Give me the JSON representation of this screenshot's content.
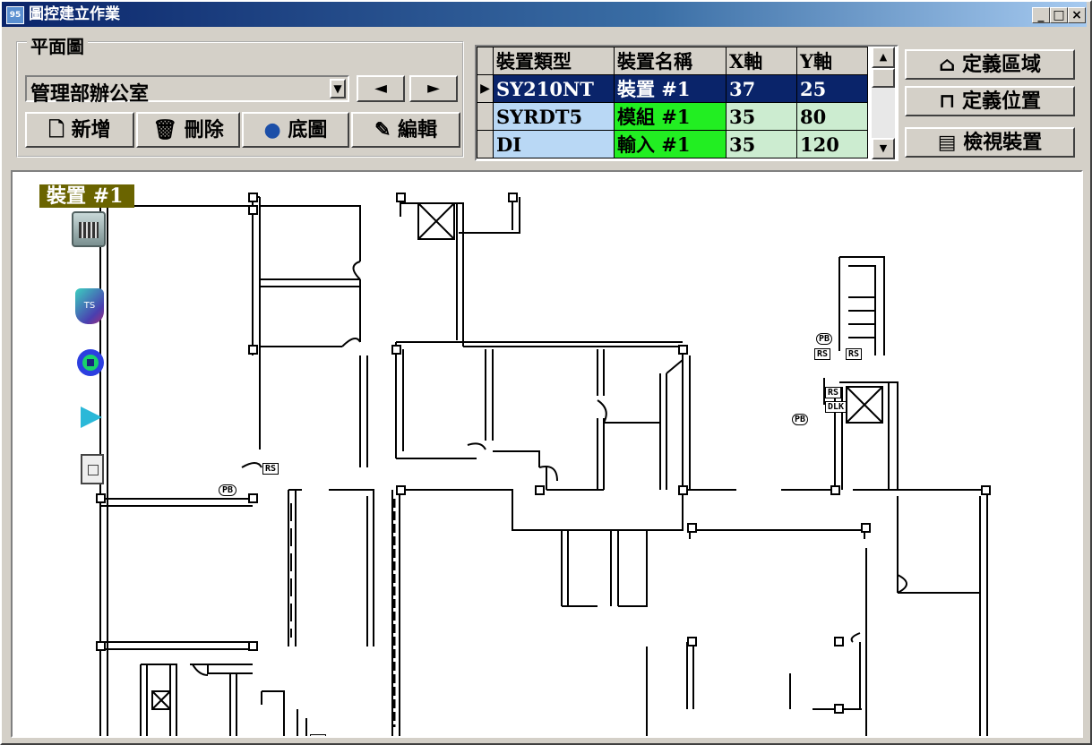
{
  "window": {
    "title": "圖控建立作業",
    "icon_text": "95"
  },
  "group": {
    "label": "平面圖",
    "combo_value": "管理部辦公室"
  },
  "buttons": {
    "prev": "◄",
    "next": "►",
    "add": "新增",
    "delete": "刪除",
    "background": "底圖",
    "edit": "編輯",
    "define_area": "定義區域",
    "define_position": "定義位置",
    "view_device": "檢視裝置"
  },
  "grid": {
    "headers": [
      "裝置類型",
      "裝置名稱",
      "X軸",
      "Y軸"
    ],
    "rows": [
      {
        "type": "SY210NT",
        "name": "裝置 #1",
        "x": "37",
        "y": "25"
      },
      {
        "type": "SYRDT5",
        "name": "模組 #1",
        "x": "35",
        "y": "80"
      },
      {
        "type": "DI",
        "name": "輸入 #1",
        "x": "35",
        "y": "120"
      }
    ]
  },
  "canvas": {
    "device_label": "裝置 #1",
    "tags": [
      "PB",
      "RS",
      "RS",
      "RS",
      "PB",
      "RS",
      "DLK",
      "PB",
      "RS"
    ]
  },
  "colors": {
    "title_start": "#0a246a",
    "selected_row": "#0a246a",
    "green_cell": "#22ee22",
    "label_bg": "#6a6400"
  }
}
